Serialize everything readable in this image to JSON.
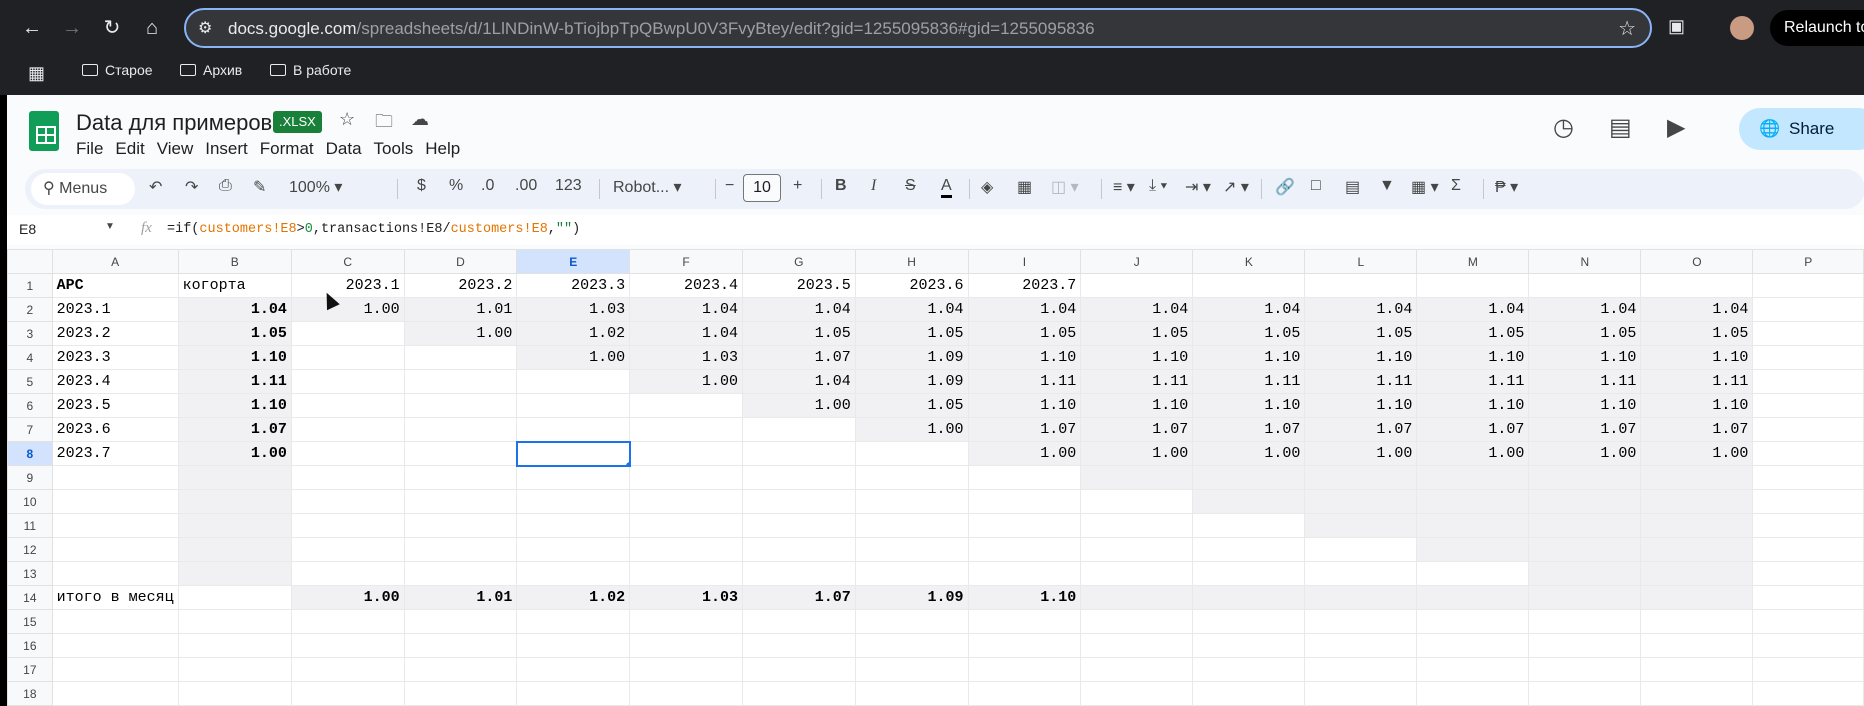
{
  "browser": {
    "url_domain": "docs.google.com",
    "url_path": "/spreadsheets/d/1LlNDinW-bTiojbpTpQBwpU0V3FvyBtey/edit?gid=1255095836#gid=1255095836",
    "relaunch_label": "Relaunch to",
    "bookmarks": [
      "Старое",
      "Архив",
      "В работе"
    ]
  },
  "doc": {
    "title": "Data для примеров",
    "badge": ".XLSX",
    "share_label": "Share",
    "menu": [
      "File",
      "Edit",
      "View",
      "Insert",
      "Format",
      "Data",
      "Tools",
      "Help"
    ]
  },
  "toolbar": {
    "search_label": "Menus",
    "zoom": "100%",
    "currency": "$",
    "percent": "%",
    "dec_decrease": ".0",
    "dec_increase": ".00",
    "number_format": "123",
    "font": "Robot...",
    "font_size": "10"
  },
  "formula_bar": {
    "cell": "E8",
    "fx": "fx",
    "p1": "=if(",
    "r1": "customers!E8",
    "p2": ">",
    "n1": "0",
    "p3": ",transactions!E8/",
    "r2": "customers!E8",
    "p4": ",",
    "s1": "\"\"",
    "p5": ")"
  },
  "grid": {
    "columns": [
      "A",
      "B",
      "C",
      "D",
      "E",
      "F",
      "G",
      "H",
      "I",
      "J",
      "K",
      "L",
      "M",
      "N",
      "O",
      "P"
    ],
    "rows": [
      [
        "APC",
        "когорта",
        "2023.1",
        "2023.2",
        "2023.3",
        "2023.4",
        "2023.5",
        "2023.6",
        "2023.7",
        "",
        "",
        "",
        "",
        "",
        "",
        ""
      ],
      [
        "2023.1",
        "1.04",
        "1.00",
        "1.01",
        "1.03",
        "1.04",
        "1.04",
        "1.04",
        "1.04",
        "1.04",
        "1.04",
        "1.04",
        "1.04",
        "1.04",
        "1.04",
        ""
      ],
      [
        "2023.2",
        "1.05",
        "",
        "1.00",
        "1.02",
        "1.04",
        "1.05",
        "1.05",
        "1.05",
        "1.05",
        "1.05",
        "1.05",
        "1.05",
        "1.05",
        "1.05",
        ""
      ],
      [
        "2023.3",
        "1.10",
        "",
        "",
        "1.00",
        "1.03",
        "1.07",
        "1.09",
        "1.10",
        "1.10",
        "1.10",
        "1.10",
        "1.10",
        "1.10",
        "1.10",
        ""
      ],
      [
        "2023.4",
        "1.11",
        "",
        "",
        "",
        "1.00",
        "1.04",
        "1.09",
        "1.11",
        "1.11",
        "1.11",
        "1.11",
        "1.11",
        "1.11",
        "1.11",
        ""
      ],
      [
        "2023.5",
        "1.10",
        "",
        "",
        "",
        "",
        "1.00",
        "1.05",
        "1.10",
        "1.10",
        "1.10",
        "1.10",
        "1.10",
        "1.10",
        "1.10",
        ""
      ],
      [
        "2023.6",
        "1.07",
        "",
        "",
        "",
        "",
        "",
        "1.00",
        "1.07",
        "1.07",
        "1.07",
        "1.07",
        "1.07",
        "1.07",
        "1.07",
        ""
      ],
      [
        "2023.7",
        "1.00",
        "",
        "",
        "",
        "",
        "",
        "",
        "1.00",
        "1.00",
        "1.00",
        "1.00",
        "1.00",
        "1.00",
        "1.00",
        ""
      ],
      [
        "",
        "",
        "",
        "",
        "",
        "",
        "",
        "",
        "",
        "",
        "",
        "",
        "",
        "",
        "",
        ""
      ],
      [
        "",
        "",
        "",
        "",
        "",
        "",
        "",
        "",
        "",
        "",
        "",
        "",
        "",
        "",
        "",
        ""
      ],
      [
        "",
        "",
        "",
        "",
        "",
        "",
        "",
        "",
        "",
        "",
        "",
        "",
        "",
        "",
        "",
        ""
      ],
      [
        "",
        "",
        "",
        "",
        "",
        "",
        "",
        "",
        "",
        "",
        "",
        "",
        "",
        "",
        "",
        ""
      ],
      [
        "",
        "",
        "",
        "",
        "",
        "",
        "",
        "",
        "",
        "",
        "",
        "",
        "",
        "",
        "",
        ""
      ],
      [
        "итого в месяц",
        "",
        "1.00",
        "1.01",
        "1.02",
        "1.03",
        "1.07",
        "1.09",
        "1.10",
        "",
        "",
        "",
        "",
        "",
        "",
        ""
      ],
      [
        "",
        "",
        "",
        "",
        "",
        "",
        "",
        "",
        "",
        "",
        "",
        "",
        "",
        "",
        "",
        ""
      ],
      [
        "",
        "",
        "",
        "",
        "",
        "",
        "",
        "",
        "",
        "",
        "",
        "",
        "",
        "",
        "",
        ""
      ],
      [
        "",
        "",
        "",
        "",
        "",
        "",
        "",
        "",
        "",
        "",
        "",
        "",
        "",
        "",
        "",
        ""
      ],
      [
        "",
        "",
        "",
        "",
        "",
        "",
        "",
        "",
        "",
        "",
        "",
        "",
        "",
        "",
        "",
        ""
      ]
    ],
    "selected_cell": "E8",
    "shade_color": "#f1f1f3",
    "selection_color": "#1a73e8"
  }
}
